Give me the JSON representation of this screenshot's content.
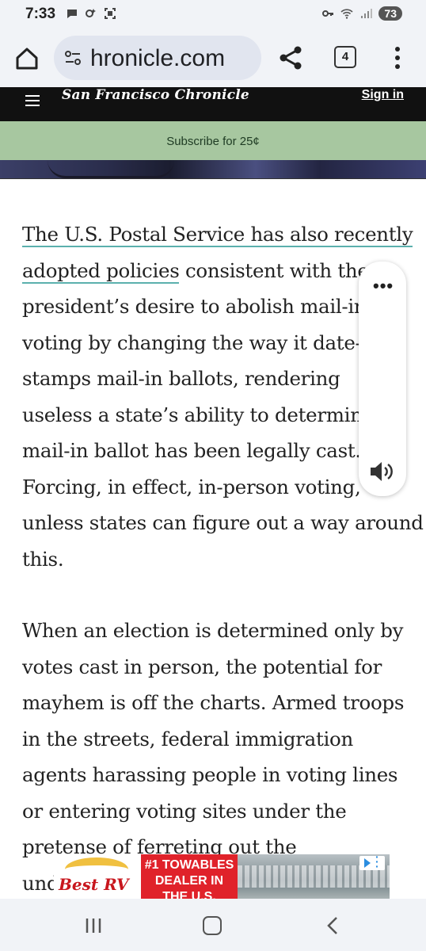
{
  "status_bar": {
    "time": "7:33",
    "battery": "73"
  },
  "browser": {
    "url": "hronicle.com",
    "tab_count": "4"
  },
  "site": {
    "logo": "San Francisco Chronicle",
    "sign_in": "Sign in",
    "subscribe": "Subscribe for 25¢"
  },
  "article": {
    "p1_link": "The U.S. Postal Service has also recently adopted policies",
    "p1_link_line1": "The U.S. Postal Service has also recently",
    "p1_link_line2": "adopted policies",
    "p1_line2_rest": " consistent with the",
    "p1_lines": [
      "president’s desire to abolish mail-in",
      "voting by changing the way it date-",
      "stamps mail-in ballots, rendering",
      "useless a state’s ability to determine",
      "mail-in ballot has been legally cast.",
      "Forcing, in effect, in-person voting,",
      "unless states can figure out a way around",
      "this."
    ],
    "p2_lines": [
      "When an election is determined only by",
      "votes cast in person, the potential for",
      "mayhem is off the charts. Armed troops",
      "in the streets, federal immigration",
      "agents harassing people in voting lines",
      "or entering voting sites under the",
      "pretense of ferreting out the",
      "und"
    ]
  },
  "ad": {
    "brand": "Best RV",
    "headline_line1": "#1 TOWABLES",
    "headline_line2": "DEALER IN",
    "headline_line3": "THE U.S."
  },
  "icons": {
    "home": "home-icon",
    "site_info": "tune-icon",
    "share": "share-icon",
    "menu": "more-vert-icon",
    "read_aloud": "speaker-icon",
    "nav_recent": "recents-icon",
    "nav_home": "home-nav-icon",
    "nav_back": "back-icon"
  },
  "colors": {
    "header_bg": "#111111",
    "subscribe_bg": "#a7c7a0",
    "link_underline": "#5bb0ad",
    "ad_red": "#e0222a"
  }
}
